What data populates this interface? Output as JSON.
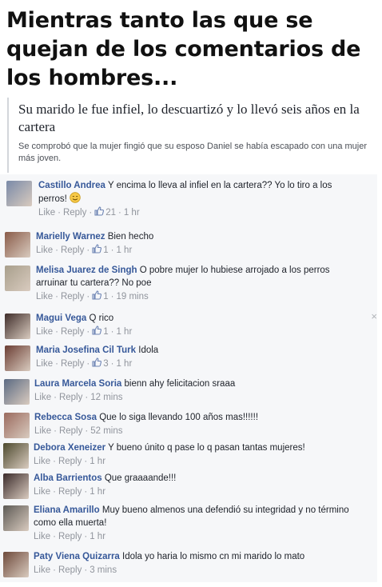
{
  "meme": {
    "title": "Mientras tanto las que se quejan de los comentarios de los hombres..."
  },
  "article": {
    "headline": "Su marido le fue infiel, lo descuartizó y lo llevó seis años en la cartera",
    "summary": "Se comprobó que la mujer fingió que su esposo Daniel se había escapado con una mujer más joven."
  },
  "actions": {
    "like": "Like",
    "reply": "Reply",
    "dot": "·"
  },
  "comments": [
    {
      "author": "Castillo Andrea",
      "text": "Y encima lo lleva al infiel en la cartera?? Yo lo tiro a los perros!",
      "likes": "21",
      "time": "1 hr",
      "avatar_color": "#7a8aa8",
      "emoji": "smile-icon"
    },
    {
      "author": "Marielly Warnez",
      "text": "Bien hecho",
      "likes": "1",
      "time": "1 hr",
      "avatar_color": "#8a5c4a"
    },
    {
      "author": "Melisa Juarez de Singh",
      "text": "O pobre mujer lo hubiese arrojado a los perros arruinar tu cartera?? No poe",
      "likes": "1",
      "time": "19 mins",
      "avatar_color": "#a89f8c"
    },
    {
      "author": "Magui Vega",
      "text": "Q rico",
      "likes": "1",
      "time": "1 hr",
      "avatar_color": "#3f2d2a"
    },
    {
      "author": "Maria Josefina Cil Turk",
      "text": "Idola",
      "likes": "3",
      "time": "1 hr",
      "avatar_color": "#6b3d33"
    },
    {
      "author": "Laura Marcela Soria",
      "text": "bienn ahy felicitacion sraaa",
      "likes": "",
      "time": "12 mins",
      "avatar_color": "#5b6a82"
    },
    {
      "author": "Rebecca Sosa",
      "text": "Que lo siga llevando 100 años mas!!!!!!",
      "likes": "",
      "time": "52 mins",
      "avatar_color": "#9a6a5e"
    },
    {
      "author": "Debora Xeneizer",
      "text": "Y bueno únito q pase lo q pasan tantas mujeres!",
      "likes": "",
      "time": "1 hr",
      "avatar_color": "#4d4a2e"
    },
    {
      "author": "Alba Barrientos",
      "text": "Que graaaande!!!",
      "likes": "",
      "time": "1 hr",
      "avatar_color": "#3a2a2a"
    },
    {
      "author": "Eliana Amarillo",
      "text": "Muy bueno almenos una defendió su integridad y no término como ella muerta!",
      "likes": "",
      "time": "1 hr",
      "avatar_color": "#5d5a55"
    },
    {
      "author": "Paty Viena Quizarra",
      "text": "Idola yo haria lo mismo cn mi marido lo mato",
      "likes": "",
      "time": "3 mins",
      "avatar_color": "#6e4a3b"
    }
  ]
}
